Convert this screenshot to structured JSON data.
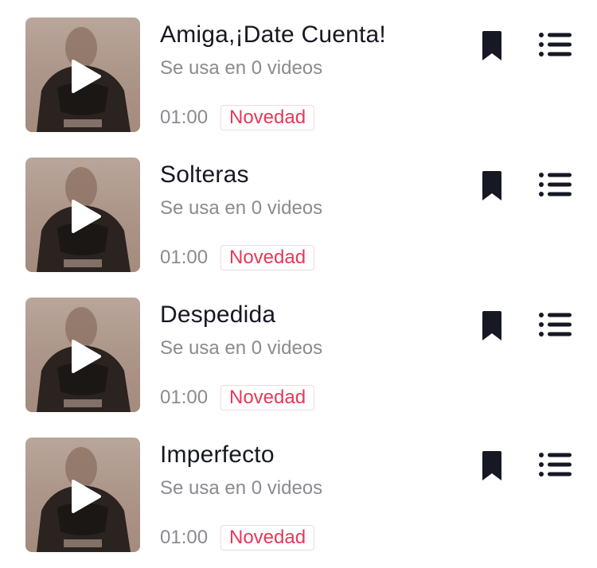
{
  "sounds": [
    {
      "title": "Amiga,¡Date Cuenta!",
      "usage": "Se usa en 0 videos",
      "duration": "01:00",
      "badge": "Novedad"
    },
    {
      "title": "Solteras",
      "usage": "Se usa en 0 videos",
      "duration": "01:00",
      "badge": "Novedad"
    },
    {
      "title": "Despedida",
      "usage": "Se usa en 0 videos",
      "duration": "01:00",
      "badge": "Novedad"
    },
    {
      "title": "Imperfecto",
      "usage": "Se usa en 0 videos",
      "duration": "01:00",
      "badge": "Novedad"
    }
  ],
  "colors": {
    "title": "#161823",
    "secondary": "#8a8b91",
    "badge_text": "#e6395a",
    "badge_border": "#f2d8dc",
    "icon": "#161823"
  },
  "icons": {
    "play": "play-icon",
    "bookmark": "bookmark-icon",
    "menu": "list-menu-icon"
  }
}
